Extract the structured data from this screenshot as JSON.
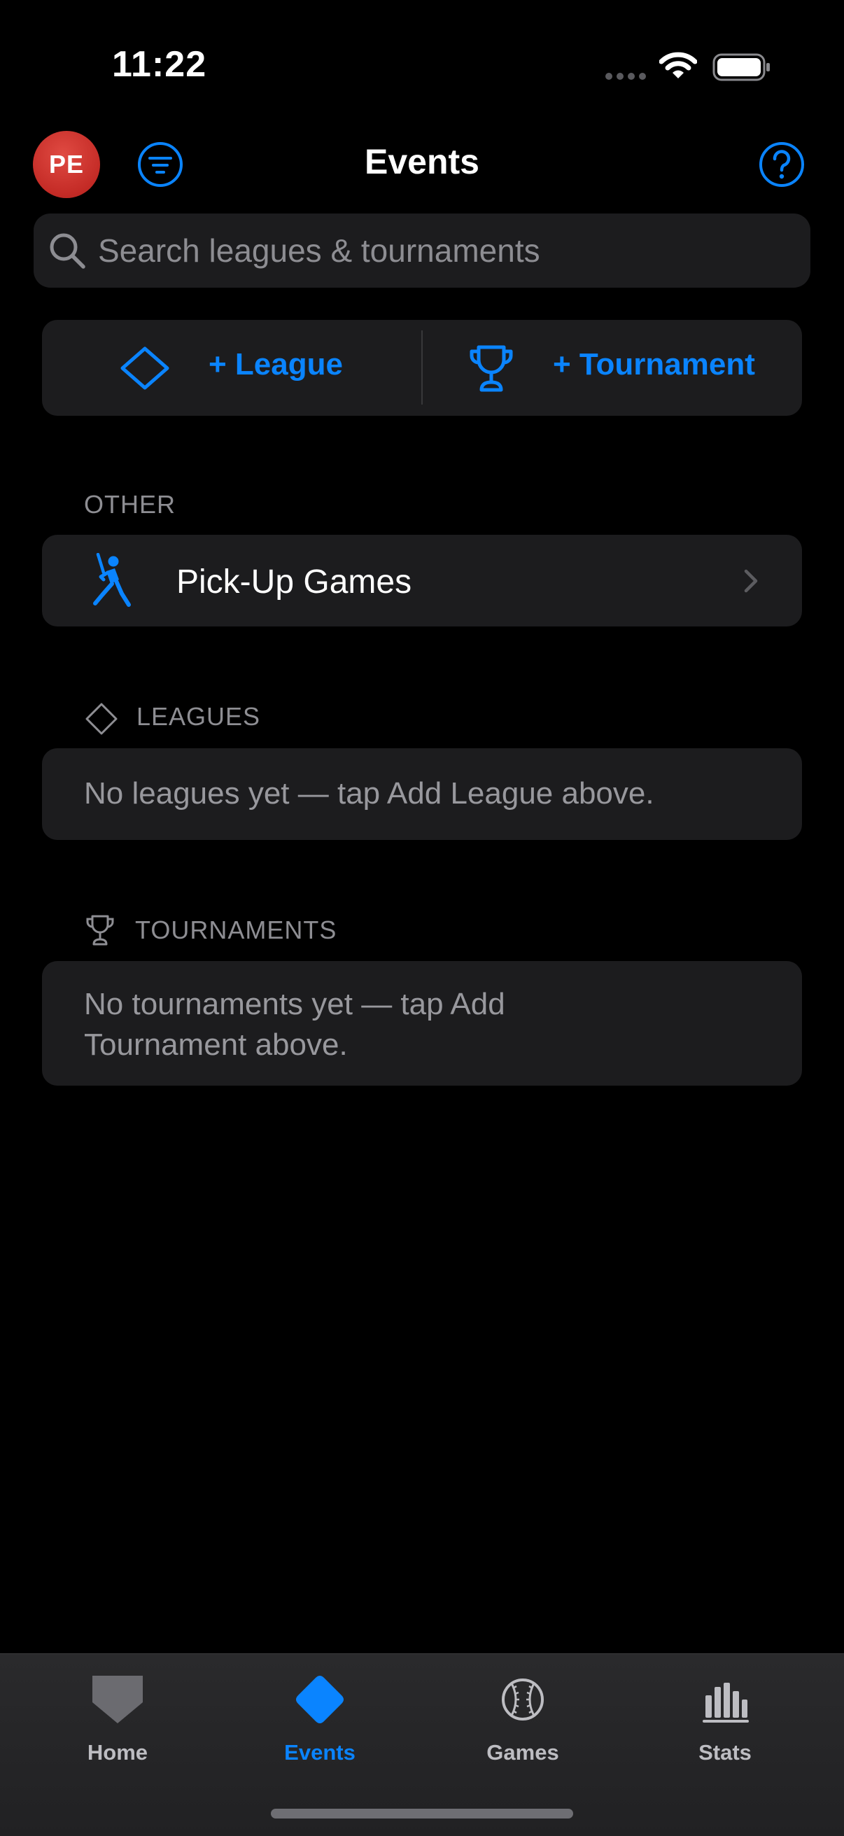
{
  "status_bar": {
    "time": "11:22"
  },
  "header": {
    "avatar_initials": "PE",
    "title": "Events"
  },
  "search": {
    "placeholder": "Search leagues & tournaments",
    "value": ""
  },
  "add_buttons": {
    "league_label": "+ League",
    "tournament_label": "+ Tournament"
  },
  "sections": {
    "other": {
      "header": "OTHER",
      "items": [
        {
          "label": "Pick-Up Games",
          "icon": "batter-icon"
        }
      ]
    },
    "leagues": {
      "header": "LEAGUES",
      "empty_text": "No leagues yet — tap Add League above."
    },
    "tournaments": {
      "header": "TOURNAMENTS",
      "empty_text": "No tournaments yet — tap Add Tournament above."
    }
  },
  "tab_bar": {
    "tabs": [
      {
        "label": "Home",
        "icon": "home-plate-icon",
        "active": false
      },
      {
        "label": "Events",
        "icon": "diamond-icon",
        "active": true
      },
      {
        "label": "Games",
        "icon": "baseball-icon",
        "active": false
      },
      {
        "label": "Stats",
        "icon": "bar-chart-icon",
        "active": false
      }
    ]
  },
  "colors": {
    "accent": "#0a84ff",
    "background": "#000000",
    "card": "#1c1c1e",
    "avatar": "#c42b26",
    "secondary_text": "#8e8e93"
  }
}
